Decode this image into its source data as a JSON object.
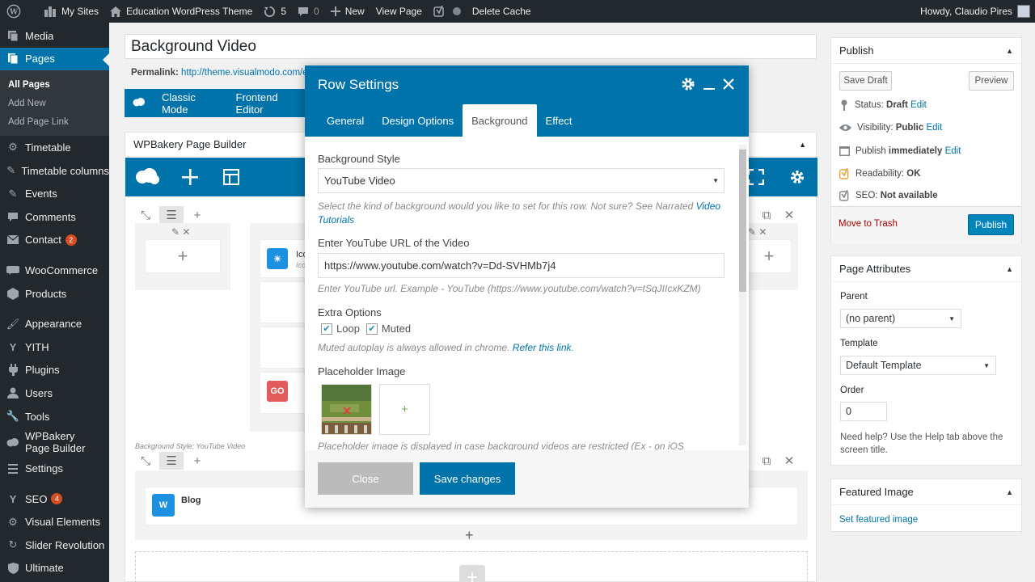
{
  "adminbar": {
    "my_sites": "My Sites",
    "site_name": "Education WordPress Theme",
    "updates": "5",
    "comments": "0",
    "new": "New",
    "view_page": "View Page",
    "delete_cache": "Delete Cache",
    "howdy": "Howdy, Claudio Pires"
  },
  "sidebar": {
    "items": [
      {
        "label": "Media",
        "icon": "media-icon"
      },
      {
        "label": "Pages",
        "icon": "pages-icon"
      },
      {
        "label": "Timetable",
        "icon": "gear-icon"
      },
      {
        "label": "Timetable columns",
        "icon": "pin-icon"
      },
      {
        "label": "Events",
        "icon": "pin-icon"
      },
      {
        "label": "Comments",
        "icon": "comment-icon"
      },
      {
        "label": "Contact",
        "icon": "mail-icon",
        "badge": "2"
      },
      {
        "label": "WooCommerce",
        "icon": "woo-icon"
      },
      {
        "label": "Products",
        "icon": "box-icon"
      },
      {
        "label": "Appearance",
        "icon": "brush-icon"
      },
      {
        "label": "YITH",
        "icon": "yith-icon"
      },
      {
        "label": "Plugins",
        "icon": "plug-icon"
      },
      {
        "label": "Users",
        "icon": "user-icon"
      },
      {
        "label": "Tools",
        "icon": "wrench-icon"
      },
      {
        "label": "WPBakery Page Builder",
        "icon": "cloud-icon"
      },
      {
        "label": "Settings",
        "icon": "settings-icon"
      },
      {
        "label": "SEO",
        "icon": "yoast-icon",
        "badge": "4"
      },
      {
        "label": "Visual Elements",
        "icon": "gear-icon"
      },
      {
        "label": "Slider Revolution",
        "icon": "refresh-icon"
      },
      {
        "label": "Ultimate",
        "icon": "shield-icon"
      }
    ],
    "submenu": [
      "All Pages",
      "Add New",
      "Add Page Link"
    ]
  },
  "editor": {
    "title": "Background Video",
    "permalink_label": "Permalink:",
    "permalink_url": "http://theme.visualmodo.com/ed",
    "classic_mode": "Classic Mode",
    "frontend_editor": "Frontend Editor",
    "builder_title": "WPBakery Page Builder",
    "icon_label": "Ico",
    "icon_sub": "Ico",
    "go_label": "GO",
    "row_note": "Background Style: YouTube Video",
    "blog_label": "Blog"
  },
  "modal": {
    "title": "Row Settings",
    "tabs": [
      "General",
      "Design Options",
      "Background",
      "Effect"
    ],
    "bg_style_label": "Background Style",
    "bg_style_value": "YouTube Video",
    "bg_style_help": "Select the kind of background would you like to set for this row. Not sure? See Narrated ",
    "bg_style_help_link": "Video Tutorials",
    "yt_label": "Enter YouTube URL of the Video",
    "yt_value": "https://www.youtube.com/watch?v=Dd-SVHMb7j4",
    "yt_help": "Enter YouTube url. Example - YouTube (https://www.youtube.com/watch?v=tSqJIIcxKZM)",
    "extra_label": "Extra Options",
    "loop": "Loop",
    "muted": "Muted",
    "extra_help": "Muted autoplay is always allowed in chrome. ",
    "extra_help_link": "Refer this link",
    "placeholder_label": "Placeholder Image",
    "placeholder_help": "Placeholder image is displayed in case background videos are restricted (Ex - on iOS devices).",
    "add_image": "+",
    "close": "Close",
    "save": "Save changes"
  },
  "publish": {
    "title": "Publish",
    "save_draft": "Save Draft",
    "preview": "Preview",
    "status_label": "Status: ",
    "status_value": "Draft",
    "visibility_label": "Visibility: ",
    "visibility_value": "Public",
    "publish_label": "Publish ",
    "publish_value": "immediately",
    "edit": "Edit",
    "readability_label": "Readability: ",
    "readability_value": "OK",
    "seo_label": "SEO: ",
    "seo_value": "Not available",
    "trash": "Move to Trash",
    "publish_btn": "Publish"
  },
  "attributes": {
    "title": "Page Attributes",
    "parent_label": "Parent",
    "parent_value": "(no parent)",
    "template_label": "Template",
    "template_value": "Default Template",
    "order_label": "Order",
    "order_value": "0",
    "help": "Need help? Use the Help tab above the screen title."
  },
  "featured": {
    "title": "Featured Image",
    "link": "Set featured image"
  },
  "colors": {
    "wp_blue": "#0073aa",
    "admin_dark": "#23282d",
    "publish_blue": "#0085ba",
    "badge": "#d54e21"
  }
}
